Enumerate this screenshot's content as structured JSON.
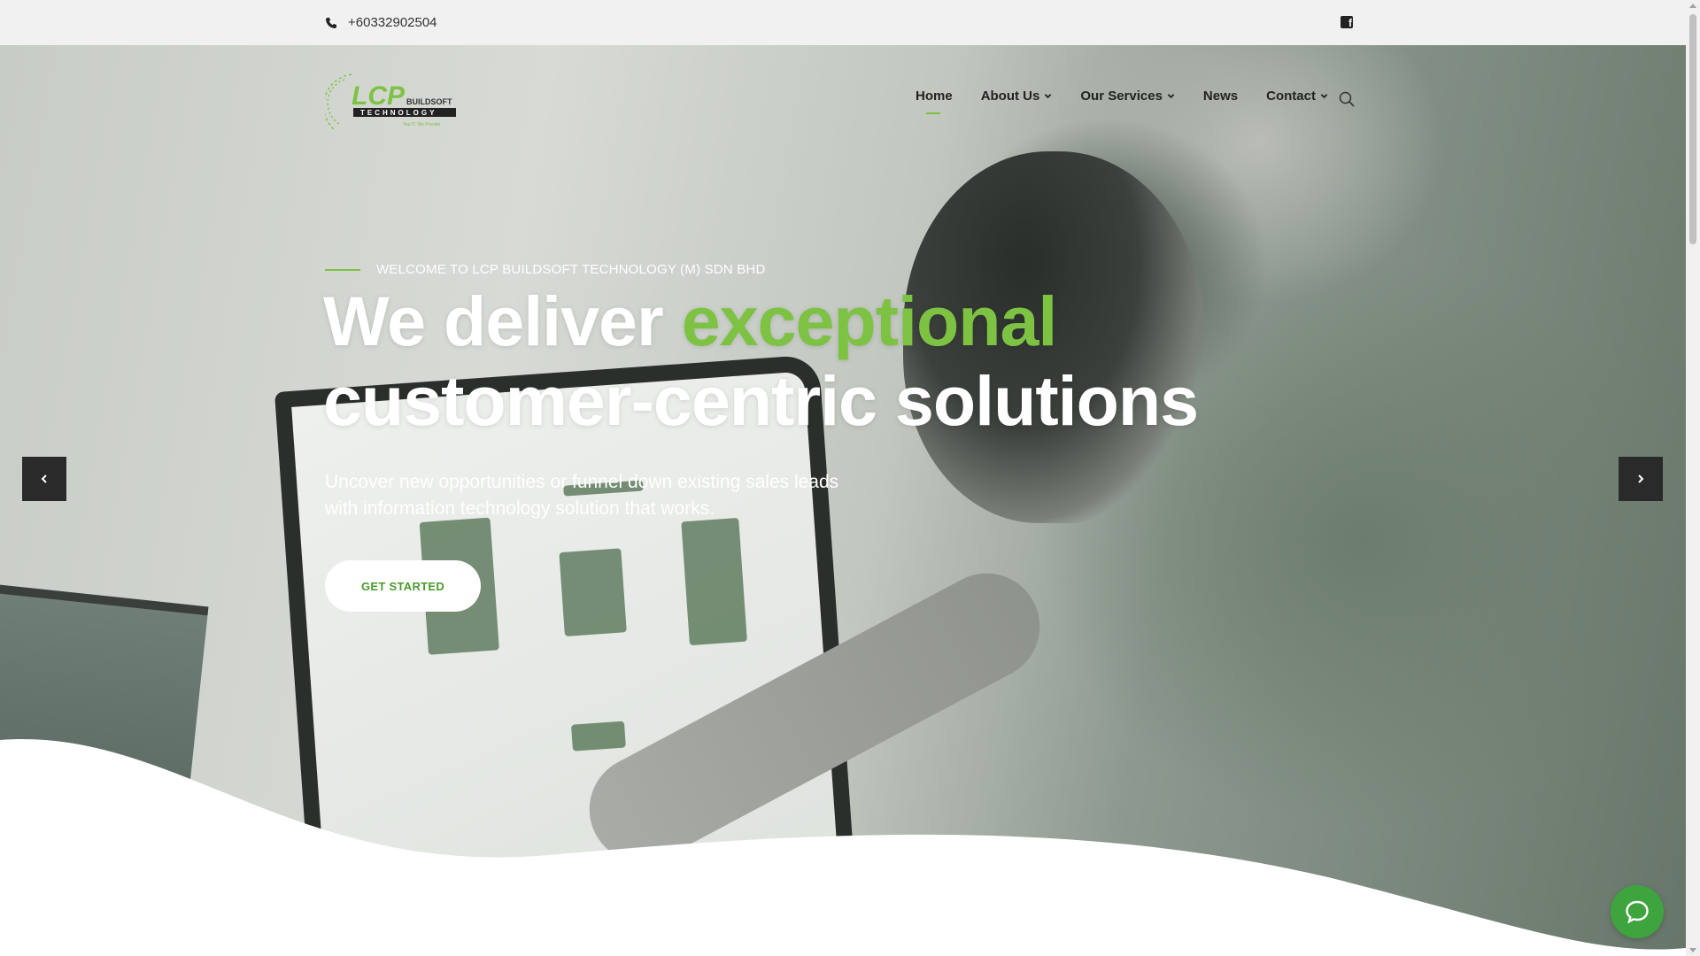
{
  "topbar": {
    "phone": "+60332902504",
    "phone_icon": "phone-icon",
    "social_icon": "facebook-icon"
  },
  "brand": {
    "logo_alt": "LCP Buildsoft Technology",
    "logo_line1": "LCP",
    "logo_line2": "BUILDSOFT",
    "logo_line3": "TECHNOLOGY",
    "logo_tagline": "You IT, We Provide"
  },
  "nav": {
    "items": [
      {
        "label": "Home",
        "active": true,
        "dropdown": false
      },
      {
        "label": "About Us",
        "active": false,
        "dropdown": true
      },
      {
        "label": "Our Services",
        "active": false,
        "dropdown": true
      },
      {
        "label": "News",
        "active": false,
        "dropdown": false
      },
      {
        "label": "Contact",
        "active": false,
        "dropdown": true
      }
    ],
    "search_icon": "search-icon"
  },
  "hero": {
    "eyebrow": "WELCOME TO LCP BUILDSOFT TECHNOLOGY (M) SDN BHD",
    "headline_part1": "We deliver ",
    "headline_accent": "exceptional",
    "headline_part2": "customer-centric solutions",
    "subtext": "Uncover new opportunities or funnel down existing sales leads with information technology solution that works.",
    "cta_label": "GET STARTED"
  },
  "colors": {
    "accent": "#7dc243",
    "cta_text": "#4a9b2d",
    "chat": "#3ea53e",
    "topbar_bg": "#f0f1f0"
  }
}
